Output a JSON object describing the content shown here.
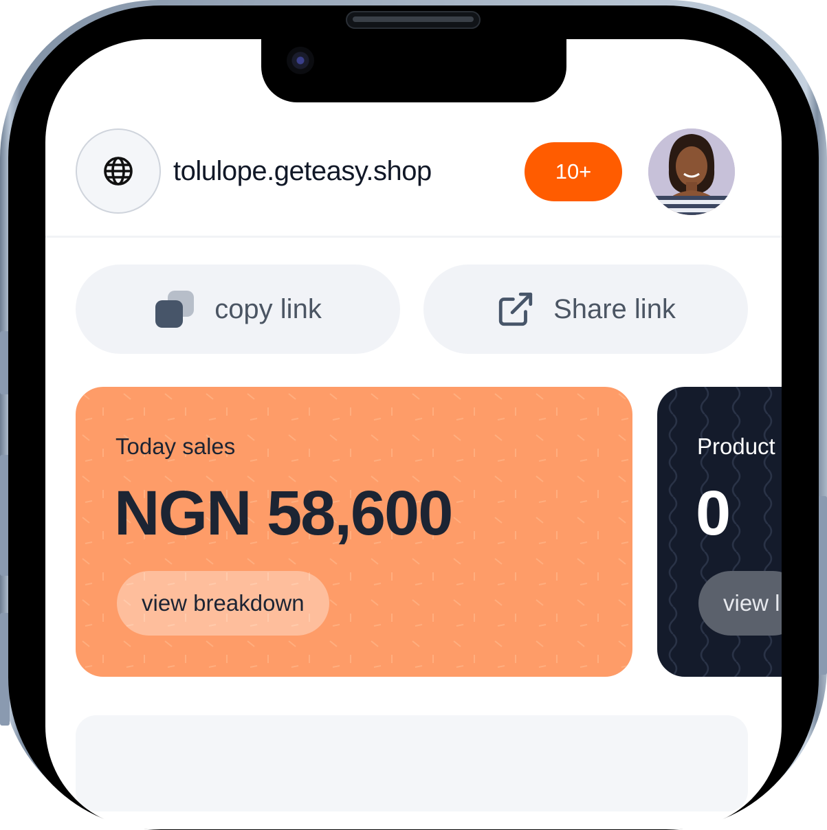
{
  "header": {
    "shop_url": "tolulope.geteasy.shop",
    "notification_badge": "10+"
  },
  "actions": {
    "copy_label": "copy link",
    "share_label": "Share link"
  },
  "cards": [
    {
      "label": "Today sales",
      "value": "NGN 58,600",
      "button": "view breakdown",
      "bg": "#fe9c68"
    },
    {
      "label": "Product",
      "value": "0",
      "button": "view l",
      "bg": "#141b2b"
    }
  ],
  "colors": {
    "accent": "#ff5c00",
    "sales_card": "#fe9c68",
    "products_card": "#141b2b"
  },
  "icons": [
    "globe-icon",
    "copy-icon",
    "share-external-icon"
  ]
}
